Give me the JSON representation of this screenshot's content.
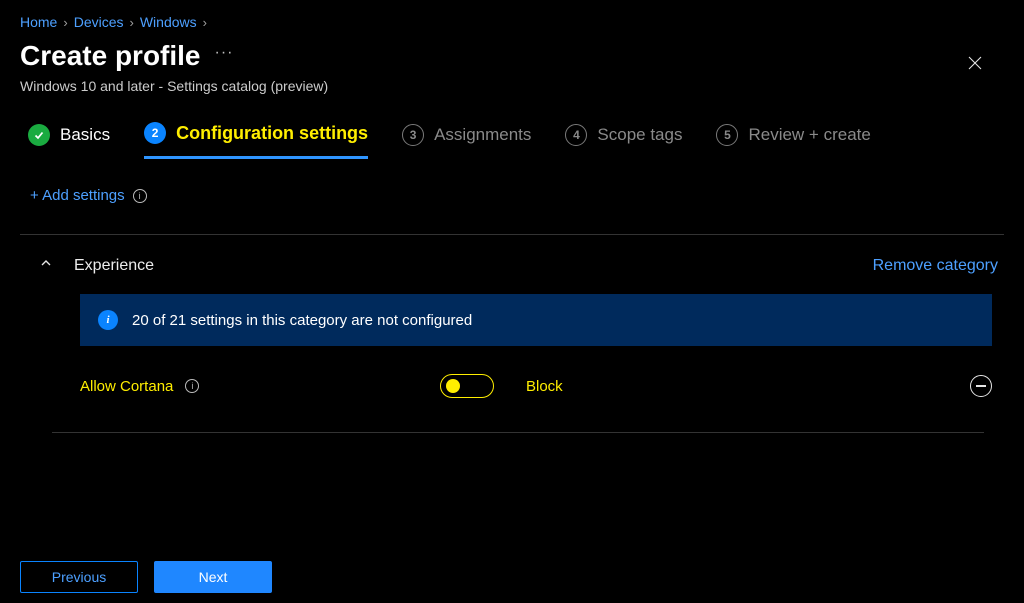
{
  "breadcrumb": {
    "items": [
      "Home",
      "Devices",
      "Windows"
    ]
  },
  "header": {
    "title": "Create profile",
    "subtitle": "Windows 10 and later - Settings catalog (preview)"
  },
  "steps": [
    {
      "label": "Basics",
      "state": "done",
      "num": ""
    },
    {
      "label": "Configuration settings",
      "state": "active",
      "num": "2"
    },
    {
      "label": "Assignments",
      "state": "pending",
      "num": "3"
    },
    {
      "label": "Scope tags",
      "state": "pending",
      "num": "4"
    },
    {
      "label": "Review + create",
      "state": "pending",
      "num": "5"
    }
  ],
  "actions": {
    "add_settings": "+ Add settings",
    "remove_category": "Remove category",
    "previous": "Previous",
    "next": "Next"
  },
  "category": {
    "name": "Experience",
    "info_message": "20 of 21 settings in this category are not configured",
    "settings": [
      {
        "name": "Allow Cortana",
        "value_label": "Block",
        "toggled": false
      }
    ]
  }
}
